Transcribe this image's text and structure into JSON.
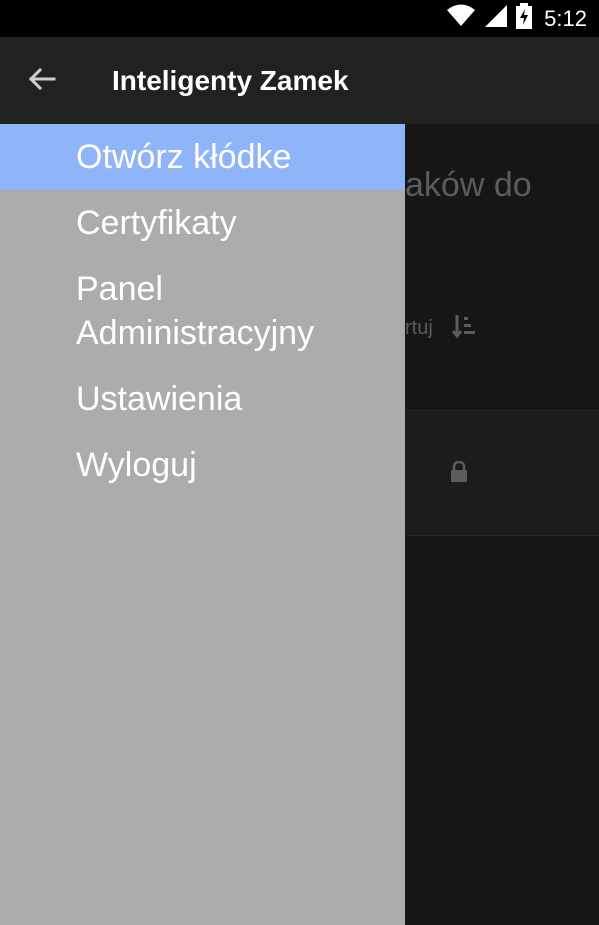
{
  "status_bar": {
    "time": "5:12",
    "icons": [
      "wifi-icon",
      "signal-icon",
      "battery-charging-icon"
    ]
  },
  "app_bar": {
    "title": "Inteligenty Zamek",
    "back_icon": "arrow-back-icon"
  },
  "background": {
    "header_fragment": "aków do",
    "sort_fragment": "rtuj",
    "sort_icon": "sort-icon",
    "card_icon": "lock-icon"
  },
  "drawer": {
    "items": [
      {
        "label": "Otwórz kłódke",
        "active": true
      },
      {
        "label": "Certyfikaty",
        "active": false
      },
      {
        "label": "Panel Administracyjny",
        "active": false
      },
      {
        "label": "Ustawienia",
        "active": false
      },
      {
        "label": "Wyloguj",
        "active": false
      }
    ]
  },
  "colors": {
    "status_bar": "#000000",
    "app_bar": "#212121",
    "drawer_bg": "#acacac",
    "drawer_active": "#8fb4f9",
    "content_bg": "#161616"
  }
}
